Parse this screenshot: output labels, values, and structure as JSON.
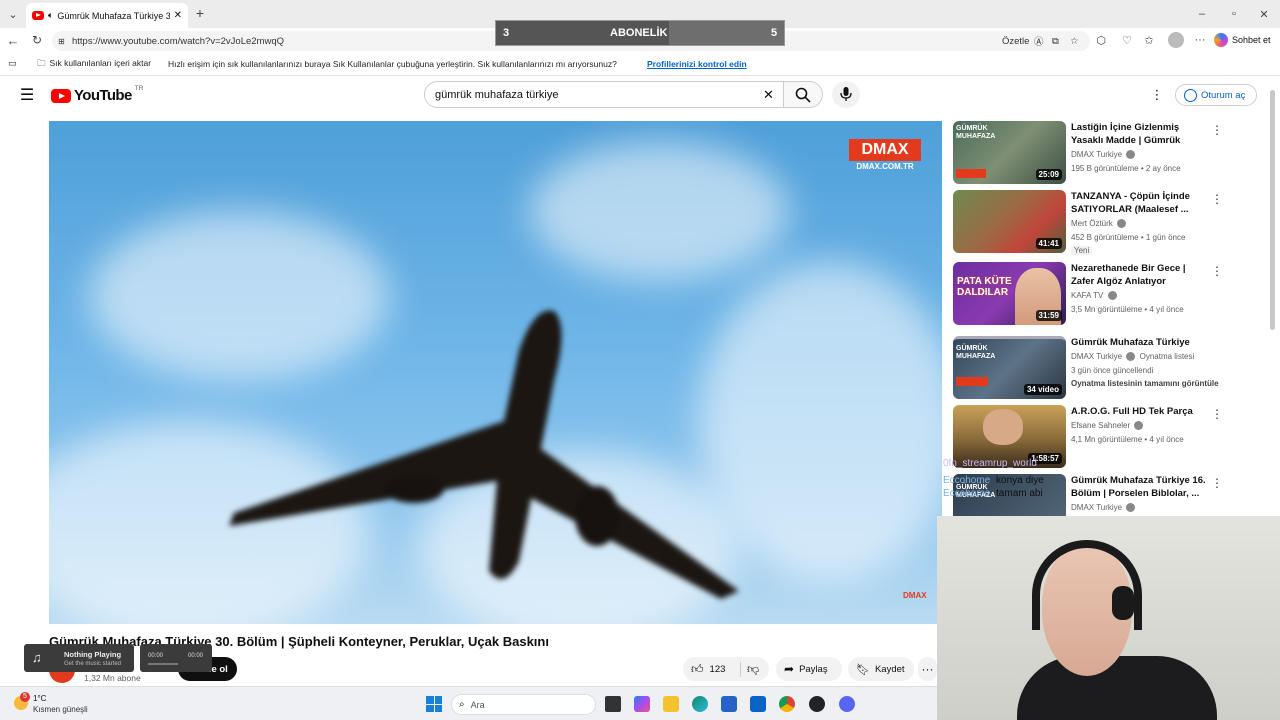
{
  "browser": {
    "tab_title": "Gümrük Muhafaza Türkiye 30",
    "url": "https://www.youtube.com/watch?v=2vJoLe2mwqQ",
    "summarize_label": "Özetle",
    "chat_label": "Sohbet et",
    "favorites": {
      "import_label": "Sık kullanılanları içeri aktar",
      "hint_text": "Hızlı erişim için sık kullanılanlarınızı buraya Sık Kullanılanlar çubuğuna yerleştirin. Sık kullanılanlarınızı mı arıyorsunuz?",
      "hint_link": "Profillerinizi kontrol edin"
    }
  },
  "overlay": {
    "left": "3",
    "label": "ABONELİK",
    "right": "5",
    "progress": 0.6
  },
  "youtube": {
    "logo_text": "YouTube",
    "region": "TR",
    "search_value": "gümrük muhafaza türkiye",
    "signin_label": "Oturum aç"
  },
  "video": {
    "watermark": "DMAX",
    "watermark_sub": "DMAX.COM.TR",
    "corner_logo": "DMAX",
    "title": "Gümrük Muhafaza Türkiye 30. Bölüm | Şüpheli Konteyner, Peruklar, Uçak Baskını",
    "subscribers": "1,32 Mn abone",
    "subscribe_label": "Abone ol",
    "likes": "123",
    "share_label": "Paylaş",
    "save_label": "Kaydet"
  },
  "recommendations": [
    {
      "title": "Lastiğin İçine Gizlenmiş Yasaklı Madde | Gümrük Muhafaza ...",
      "channel": "DMAX Turkiye",
      "meta": "195 B görüntüleme • 2 ay önce",
      "duration": "25:09"
    },
    {
      "title": "TANZANYA - Çöpün İçinde SATIYORLAR (Maalesef ...",
      "channel": "Mert Öztürk",
      "meta": "452 B görüntüleme • 1 gün önce",
      "badge": "Yeni",
      "duration": "41:41"
    },
    {
      "title": "Nezarethanede Bir Gece | Zafer Algöz Anlatıyor",
      "channel": "KAFA TV",
      "meta": "3,5 Mn görüntüleme • 4 yıl önce",
      "duration": "31:59",
      "thumb_text": "PATA KÜTE DALDILAR"
    },
    {
      "title": "Gümrük Muhafaza Türkiye",
      "channel": "DMAX Turkiye",
      "channel_extra": "Oynatma listesi",
      "meta": "3 gün önce güncellendi",
      "meta2": "Oynatma listesinin tamamını görüntüle",
      "duration": "34 video"
    },
    {
      "title": "A.R.O.G. Full HD Tek Parça",
      "channel": "Efsane Sahneler",
      "meta": "4,1 Mn görüntüleme • 4 yıl önce",
      "duration": "1:58:57"
    },
    {
      "title": "Gümrük Muhafaza Türkiye 16. Bölüm | Porselen Biblolar, ...",
      "channel": "DMAX Turkiye",
      "meta": "",
      "duration": ""
    }
  ],
  "chat_overlay": [
    {
      "user": "0fn_streamrup_world",
      "text": ""
    },
    {
      "user": "Eccohome",
      "text": "konya diye"
    },
    {
      "user": "Eccohome",
      "text": "tamam abi"
    }
  ],
  "music_widget": {
    "status": "Nothing Playing",
    "sub": "Get the music started",
    "time_start": "00:00",
    "time_end": "00:00"
  },
  "taskbar": {
    "weather_temp": "1°C",
    "weather_desc": "Kısmen güneşli",
    "weather_badge": "5",
    "search_placeholder": "Ara"
  }
}
